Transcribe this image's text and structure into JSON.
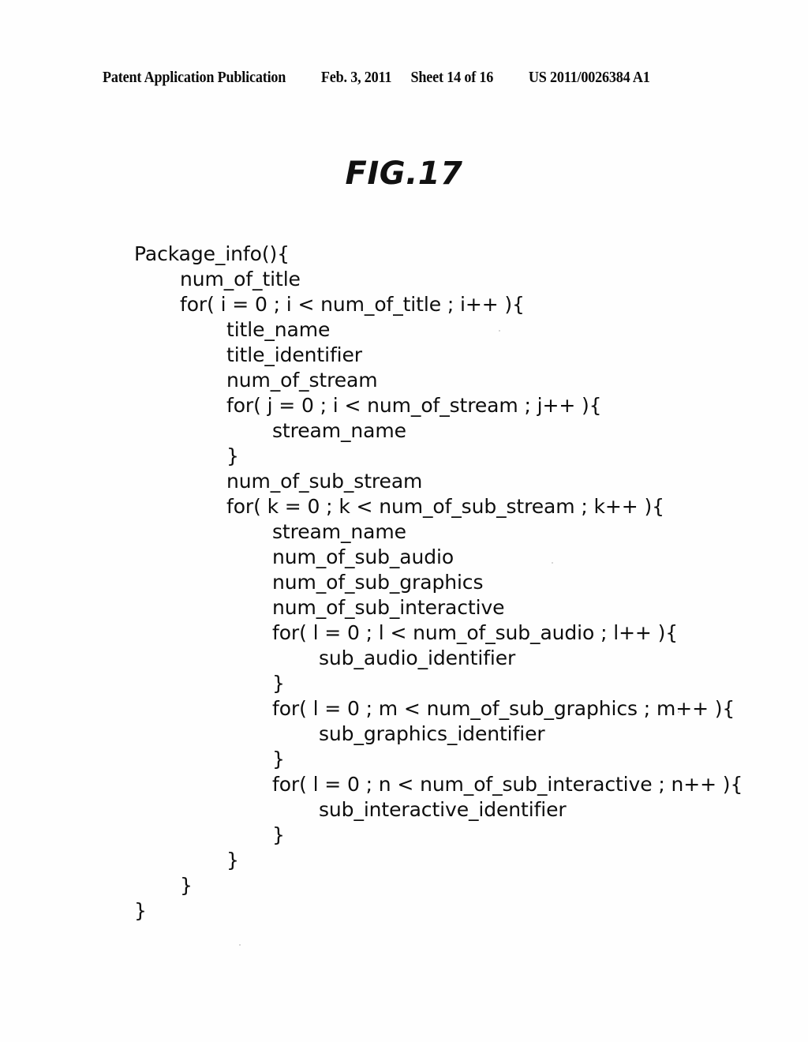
{
  "header": {
    "publication": "Patent Application Publication",
    "date": "Feb. 3, 2011",
    "sheet": "Sheet 14 of 16",
    "doc_number": "US 2011/0026384 A1"
  },
  "figure": {
    "title": "FIG.17"
  },
  "code": {
    "language": "pseudo-code",
    "lines": [
      {
        "indent": 0,
        "text": "Package_info(){"
      },
      {
        "indent": 1,
        "text": "num_of_title"
      },
      {
        "indent": 1,
        "text": "for( i = 0 ; i < num_of_title ; i++ ){"
      },
      {
        "indent": 2,
        "text": "title_name"
      },
      {
        "indent": 2,
        "text": "title_identifier"
      },
      {
        "indent": 2,
        "text": "num_of_stream"
      },
      {
        "indent": 2,
        "text": "for( j = 0 ; i < num_of_stream ; j++ ){"
      },
      {
        "indent": 3,
        "text": "stream_name"
      },
      {
        "indent": 2,
        "text": "}"
      },
      {
        "indent": 2,
        "text": "num_of_sub_stream"
      },
      {
        "indent": 2,
        "text": "for( k = 0 ; k < num_of_sub_stream ; k++ ){"
      },
      {
        "indent": 3,
        "text": "stream_name"
      },
      {
        "indent": 3,
        "text": "num_of_sub_audio"
      },
      {
        "indent": 3,
        "text": "num_of_sub_graphics"
      },
      {
        "indent": 3,
        "text": "num_of_sub_interactive"
      },
      {
        "indent": 3,
        "text": "for( l = 0 ; l < num_of_sub_audio ; l++ ){"
      },
      {
        "indent": 4,
        "text": "sub_audio_identifier"
      },
      {
        "indent": 3,
        "text": "}"
      },
      {
        "indent": 3,
        "text": "for( l = 0 ; m < num_of_sub_graphics ; m++ ){"
      },
      {
        "indent": 4,
        "text": "sub_graphics_identifier"
      },
      {
        "indent": 3,
        "text": "}"
      },
      {
        "indent": 3,
        "text": "for( l = 0 ; n < num_of_sub_interactive ; n++ ){"
      },
      {
        "indent": 4,
        "text": "sub_interactive_identifier"
      },
      {
        "indent": 3,
        "text": "}"
      },
      {
        "indent": 2,
        "text": "}"
      },
      {
        "indent": 1,
        "text": "}"
      },
      {
        "indent": 0,
        "text": "}"
      }
    ]
  }
}
